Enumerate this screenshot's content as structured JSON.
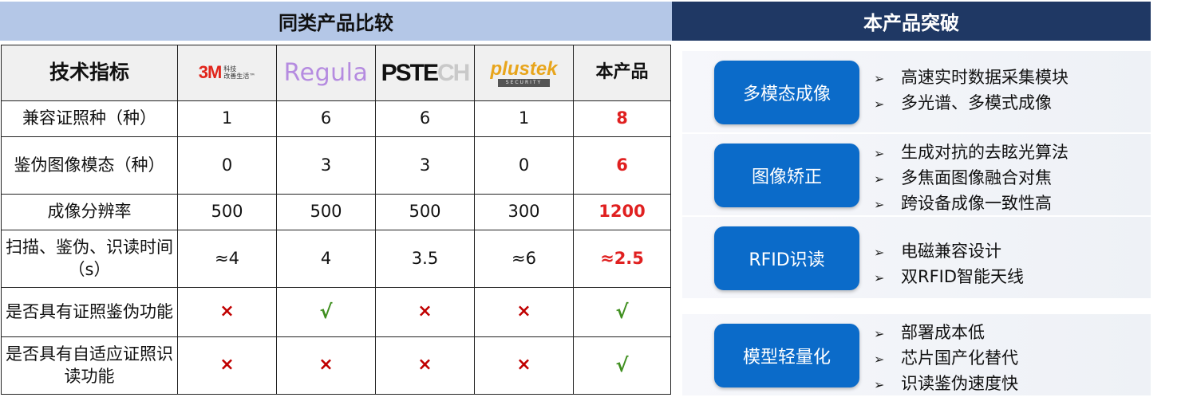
{
  "left_title": "同类产品比较",
  "right_title": "本产品突破",
  "table": {
    "header": {
      "metric": "技术指标",
      "brand_3m": {
        "mark": "3M",
        "tag_line1": "科技",
        "tag_line2": "改善生活™"
      },
      "brand_regula": "Regula",
      "brand_pstech": {
        "bold": "PSTE",
        "faded": "CH"
      },
      "brand_plustek": {
        "name": "plustek",
        "sub": "SECURITY"
      },
      "ours": "本产品"
    },
    "rows": [
      {
        "metric": "兼容证照种（种）",
        "v3m": "1",
        "regula": "6",
        "pstech": "6",
        "plustek": "1",
        "ours": "8"
      },
      {
        "metric": "鉴伪图像模态（种）",
        "v3m": "0",
        "regula": "3",
        "pstech": "3",
        "plustek": "0",
        "ours": "6"
      },
      {
        "metric": "成像分辨率",
        "v3m": "500",
        "regula": "500",
        "pstech": "500",
        "plustek": "300",
        "ours": "1200"
      },
      {
        "metric": "扫描、鉴伪、识读时间（s）",
        "v3m": "≈4",
        "regula": "4",
        "pstech": "3.5",
        "plustek": "≈6",
        "ours": "≈2.5"
      },
      {
        "metric": "是否具有证照鉴伪功能",
        "v3m": "×",
        "regula": "√",
        "pstech": "×",
        "plustek": "×",
        "ours": "√"
      },
      {
        "metric": "是否具有自适应证照识读功能",
        "v3m": "×",
        "regula": "×",
        "pstech": "×",
        "plustek": "×",
        "ours": "√"
      }
    ]
  },
  "features": [
    {
      "label": "多模态成像",
      "bullets": [
        "高速实时数据采集模块",
        "多光谱、多模式成像"
      ]
    },
    {
      "label": "图像矫正",
      "bullets": [
        "生成对抗的去眩光算法",
        "多焦面图像融合对焦",
        "跨设备成像一致性高"
      ]
    },
    {
      "label": "RFID识读",
      "bullets": [
        "电磁兼容设计",
        "双RFID智能天线"
      ]
    },
    {
      "label": "模型轻量化",
      "bullets": [
        "部署成本低",
        "芯片国产化替代",
        "识读鉴伪速度快"
      ]
    }
  ],
  "colors": {
    "left_header_bg": "#b4c7e7",
    "right_header_bg": "#1f3864",
    "pill_bg": "#0b6bc9",
    "ours_value": "#e02020",
    "cross": "#c00000",
    "check": "#3f8f1f"
  },
  "icons": {
    "bullet": "arrow-bullet-icon",
    "yes": "check-icon",
    "no": "cross-icon"
  }
}
